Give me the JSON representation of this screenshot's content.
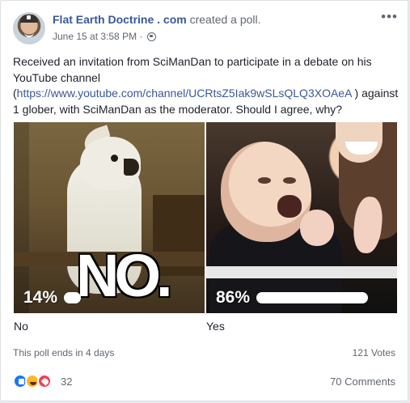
{
  "post": {
    "author": "Flat Earth Doctrine . com",
    "action": "created a poll.",
    "date": "June 15 at 3:58 PM",
    "separator": "·",
    "more": "•••",
    "message_before_link": "Received an invitation from SciManDan to participate in a debate on his YouTube channel (",
    "link_text": "https://www.youtube.com/channel/UCRtsZ5Iak9wSLsQLQ3XOAeA",
    "message_after_link": " ) against 1 glober, with SciManDan as the moderator. Should I agree, why?"
  },
  "poll": {
    "options": [
      {
        "label": "No",
        "percent_text": "14%",
        "percent": 14,
        "image_text": "NO."
      },
      {
        "label": "Yes",
        "percent_text": "86%",
        "percent": 86
      }
    ],
    "ends_text": "This poll ends in 4 days",
    "votes_text": "121 Votes"
  },
  "engagement": {
    "reaction_count": "32",
    "comments_text": "70 Comments",
    "reaction_icons": [
      "like-icon",
      "haha-icon",
      "love-icon"
    ]
  },
  "colors": {
    "link": "#385898",
    "secondary_text": "#606770",
    "primary_text": "#1d2129"
  }
}
